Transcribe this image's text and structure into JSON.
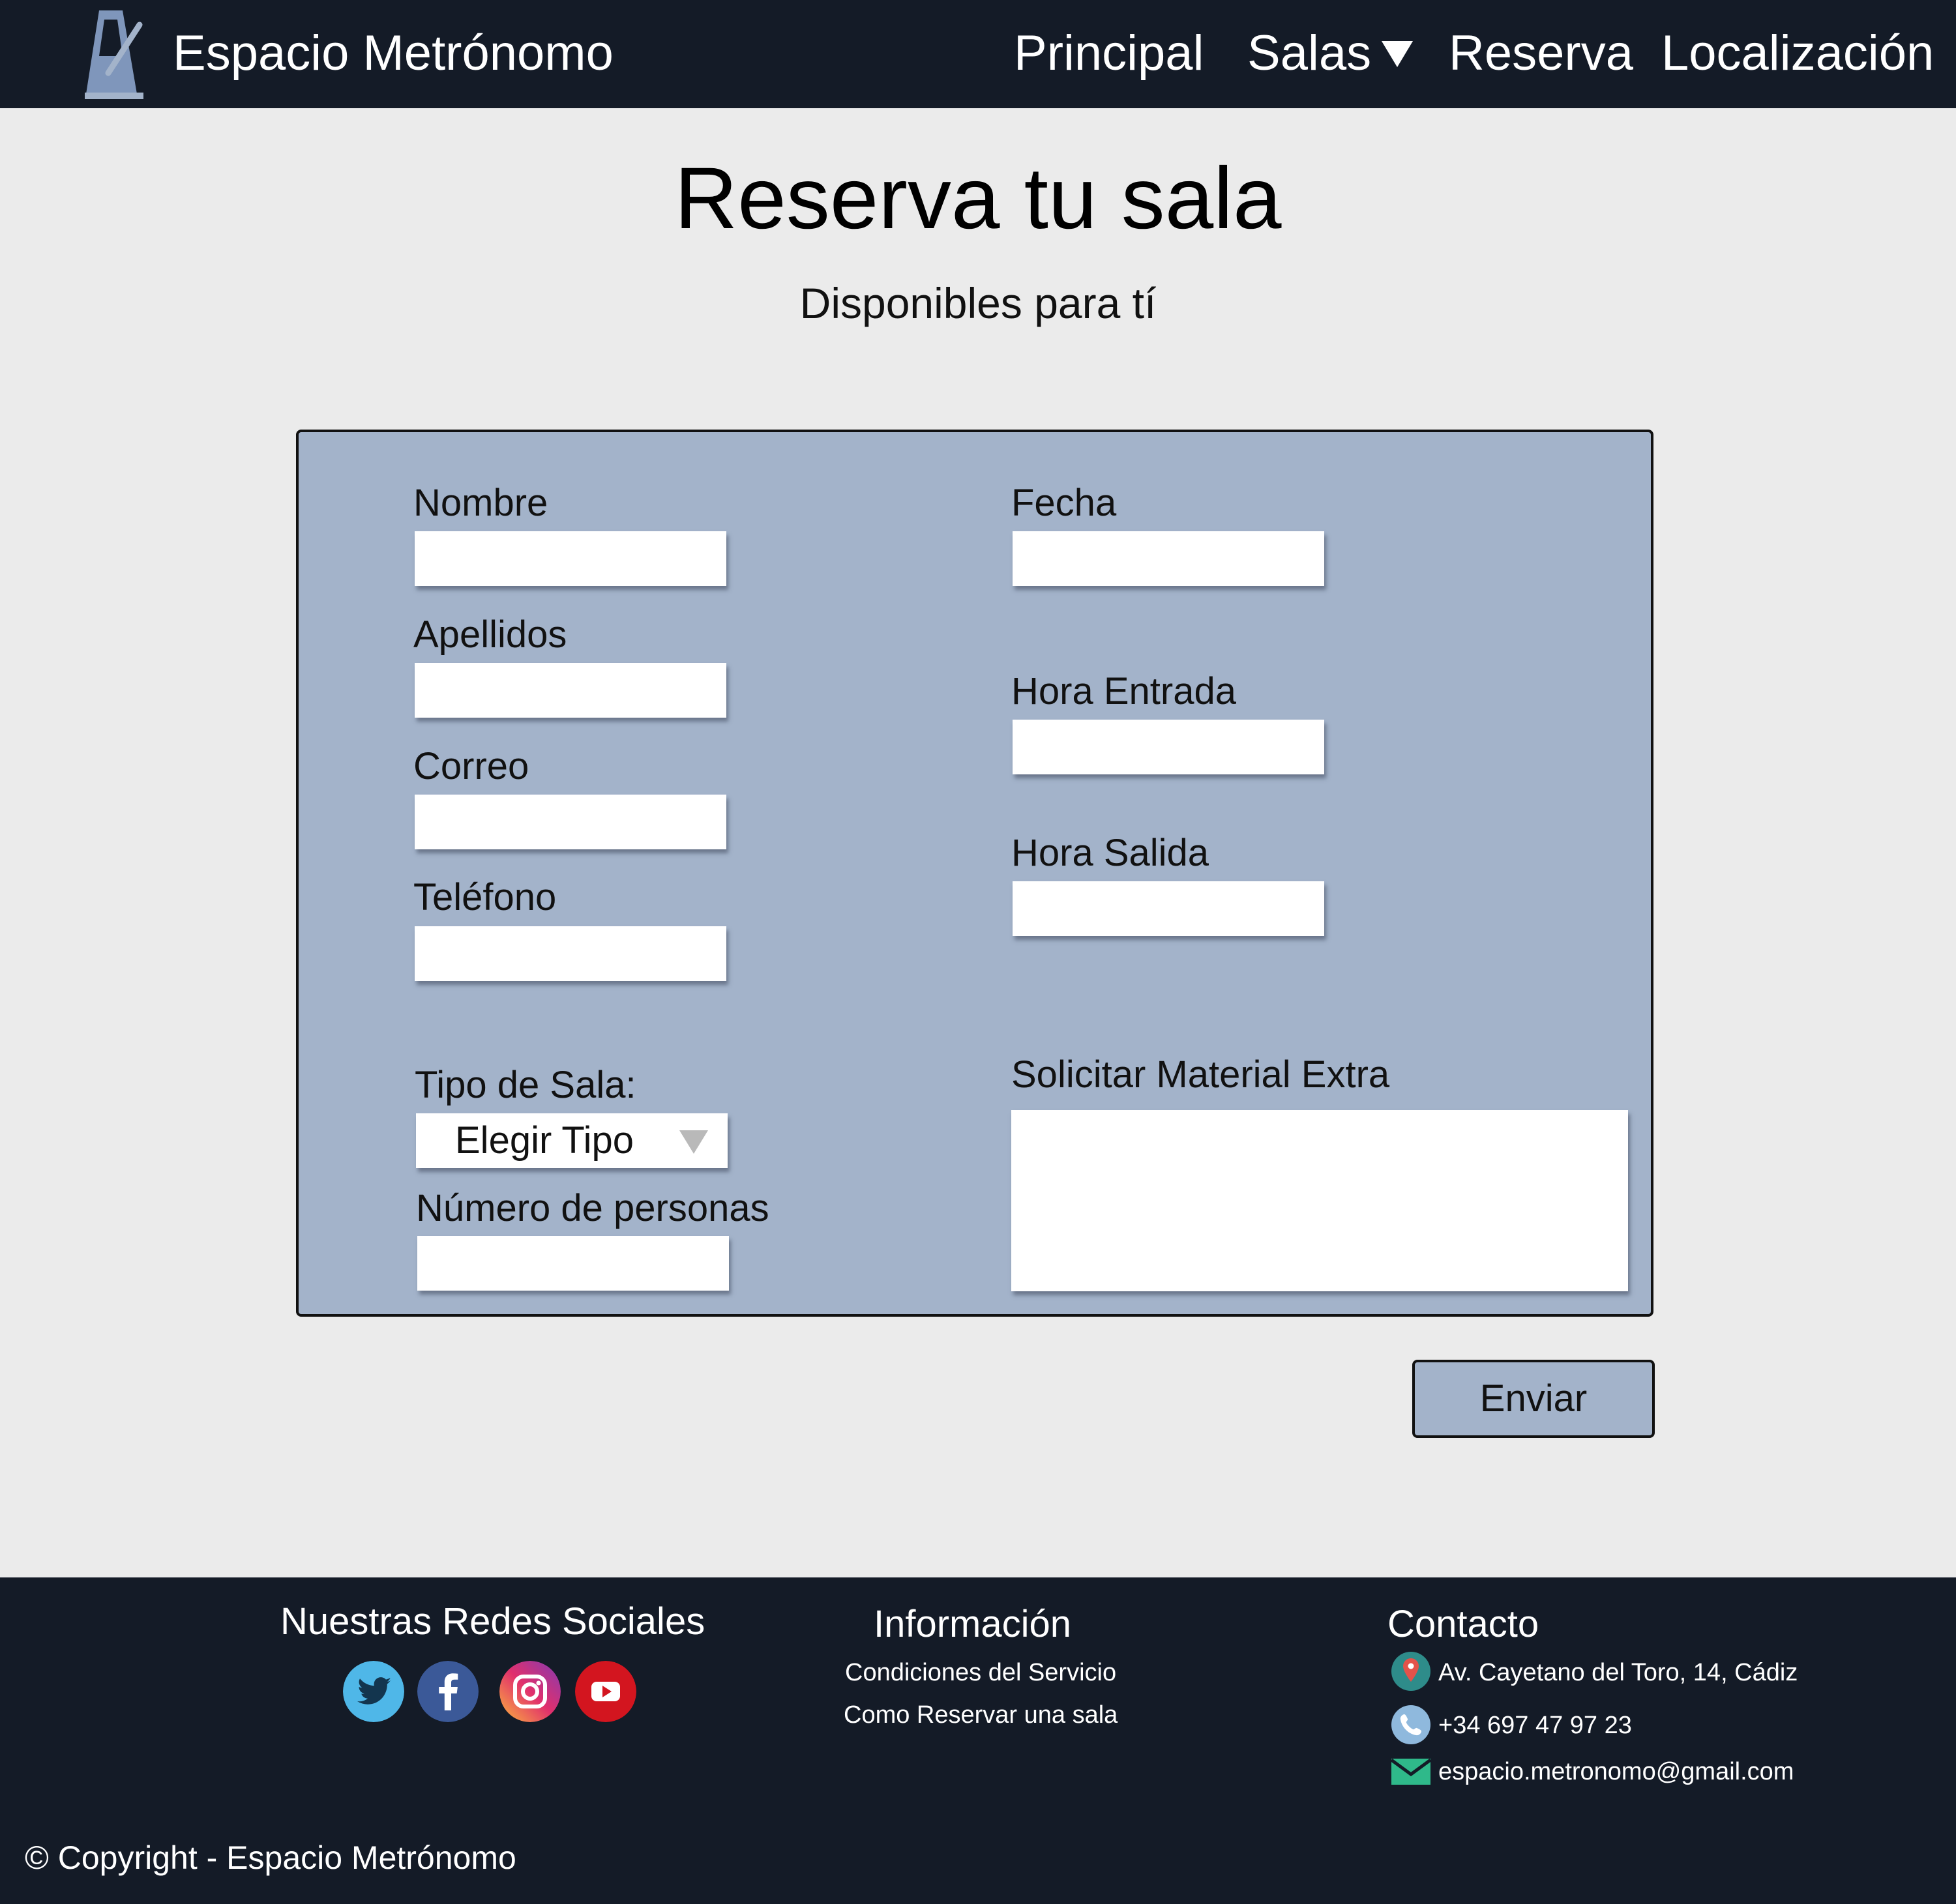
{
  "navbar": {
    "brand": "Espacio Metrónomo",
    "items": [
      "Principal",
      "Salas",
      "Reserva",
      "Localización"
    ],
    "brand_color": "#141b27"
  },
  "page": {
    "title": "Reserva tu sala",
    "subtitle": "Disponibles para tí"
  },
  "form": {
    "panel_color": "#a3b3ca",
    "labels": {
      "nombre": "Nombre",
      "apellidos": "Apellidos",
      "correo": "Correo",
      "telefono": "Teléfono",
      "tipo_sala": "Tipo de Sala:",
      "numero_personas": "Número de personas",
      "fecha": "Fecha",
      "hora_entrada": "Hora Entrada",
      "hora_salida": "Hora Salida",
      "material_extra": "Solicitar Material Extra"
    },
    "tipo_sala_selected": "Elegir Tipo",
    "submit_label": "Enviar"
  },
  "footer": {
    "social_heading": "Nuestras Redes Sociales",
    "social_icons": [
      "twitter-icon",
      "facebook-icon",
      "instagram-icon",
      "youtube-icon"
    ],
    "info_heading": "Información",
    "info_links": [
      "Condiciones del Servicio",
      "Como Reservar una sala"
    ],
    "contact_heading": "Contacto",
    "contact": {
      "address": "Av. Cayetano del Toro, 14, Cádiz",
      "phone": "+34 697 47 97 23",
      "email": "espacio.metronomo@gmail.com"
    },
    "copyright": "© Copyright - Espacio Metrónomo"
  }
}
